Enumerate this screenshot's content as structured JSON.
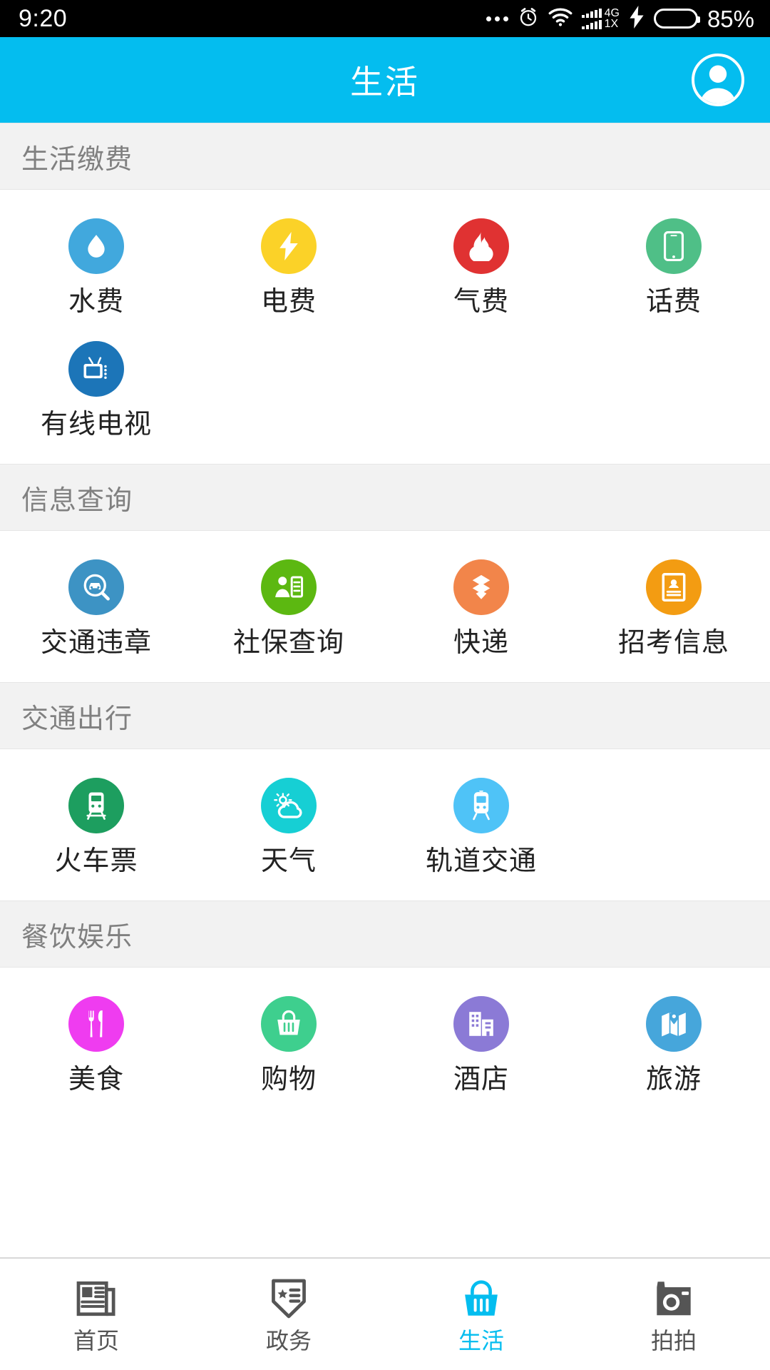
{
  "status_bar": {
    "time": "9:20",
    "network_top": "4G",
    "network_bottom": "1X",
    "battery_percent": "85%",
    "battery_level": 85,
    "icons": [
      "more-dots-icon",
      "alarm-clock-icon",
      "wifi-icon",
      "signal-bars-icon",
      "charging-bolt-icon",
      "battery-icon"
    ]
  },
  "header": {
    "title": "生活",
    "background_color": "#04bdef",
    "avatar_icon": "user-avatar-icon"
  },
  "sections": [
    {
      "title": "生活缴费",
      "items": [
        {
          "label": "水费",
          "icon": "water-drop-icon",
          "color": "#41a8dd"
        },
        {
          "label": "电费",
          "icon": "lightning-bolt-icon",
          "color": "#fbd228"
        },
        {
          "label": "气费",
          "icon": "flame-icon",
          "color": "#e03232"
        },
        {
          "label": "话费",
          "icon": "smartphone-icon",
          "color": "#4fbf87"
        },
        {
          "label": "有线电视",
          "icon": "television-icon",
          "color": "#1c75b8"
        }
      ]
    },
    {
      "title": "信息查询",
      "items": [
        {
          "label": "交通违章",
          "icon": "car-search-icon",
          "color": "#3d93c4"
        },
        {
          "label": "社保查询",
          "icon": "person-card-icon",
          "color": "#5cb811"
        },
        {
          "label": "快递",
          "icon": "package-box-icon",
          "color": "#f2854a"
        },
        {
          "label": "招考信息",
          "icon": "id-document-icon",
          "color": "#f39c12"
        }
      ]
    },
    {
      "title": "交通出行",
      "items": [
        {
          "label": "火车票",
          "icon": "train-icon",
          "color": "#1d9e5f"
        },
        {
          "label": "天气",
          "icon": "sun-cloud-icon",
          "color": "#16cfd4"
        },
        {
          "label": "轨道交通",
          "icon": "metro-train-icon",
          "color": "#4fc3f7"
        }
      ]
    },
    {
      "title": "餐饮娱乐",
      "items": [
        {
          "label": "美食",
          "icon": "fork-knife-icon",
          "color": "#ef3cf0"
        },
        {
          "label": "购物",
          "icon": "shopping-basket-icon",
          "color": "#3ecf8e"
        },
        {
          "label": "酒店",
          "icon": "buildings-icon",
          "color": "#8b7ad6"
        },
        {
          "label": "旅游",
          "icon": "map-pin-icon",
          "color": "#46a6db"
        }
      ]
    }
  ],
  "tabbar": {
    "active_color": "#04bdef",
    "inactive_color": "#555555",
    "tabs": [
      {
        "label": "首页",
        "icon": "newspaper-icon",
        "active": false
      },
      {
        "label": "政务",
        "icon": "shield-badge-icon",
        "active": false
      },
      {
        "label": "生活",
        "icon": "basket-icon",
        "active": true
      },
      {
        "label": "拍拍",
        "icon": "camera-icon",
        "active": false
      }
    ]
  }
}
